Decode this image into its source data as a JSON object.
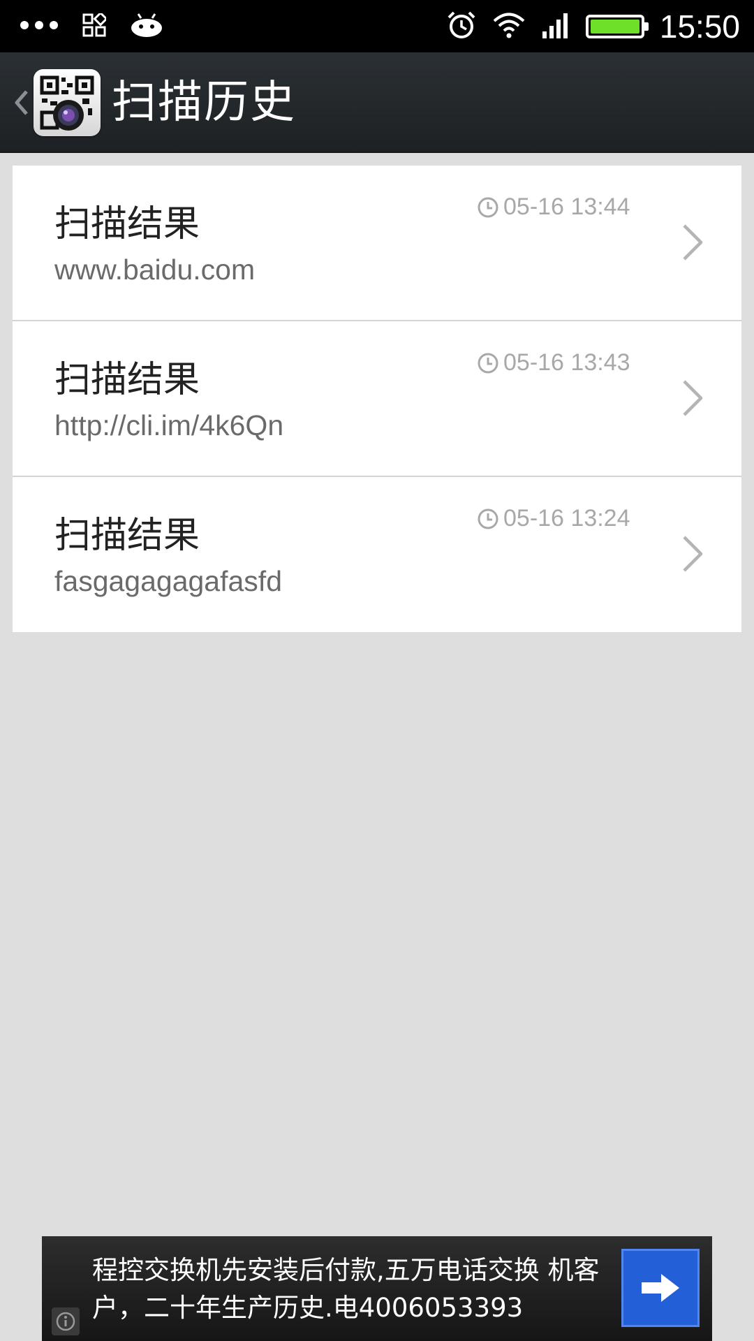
{
  "status_bar": {
    "time": "15:50",
    "battery_level": 1.0,
    "icons": [
      "more-dots-icon",
      "apps-grid-icon",
      "android-icon",
      "alarm-icon",
      "wifi-icon",
      "signal-icon",
      "battery-icon"
    ]
  },
  "header": {
    "title": "扫描历史",
    "back_icon": "chevron-left-icon",
    "app_icon": "qr-scanner-app-icon"
  },
  "history": {
    "items": [
      {
        "title": "扫描结果",
        "content": "www.baidu.com",
        "time": "05-16 13:44"
      },
      {
        "title": "扫描结果",
        "content": "http://cli.im/4k6Qn",
        "time": "05-16 13:43"
      },
      {
        "title": "扫描结果",
        "content": "fasgagagagafasfd",
        "time": "05-16 13:24"
      }
    ]
  },
  "ad": {
    "text": "程控交换机先安装后付款,五万电话交换 机客户，二十年生产历史.电4006053393",
    "info_icon": "info-icon",
    "go_icon": "arrow-right-icon"
  },
  "colors": {
    "page_background": "#dedede",
    "status_bar": "#000000",
    "title_bar": "#23282b",
    "battery_fill": "#6ee02a",
    "ad_button": "#2360d8"
  }
}
